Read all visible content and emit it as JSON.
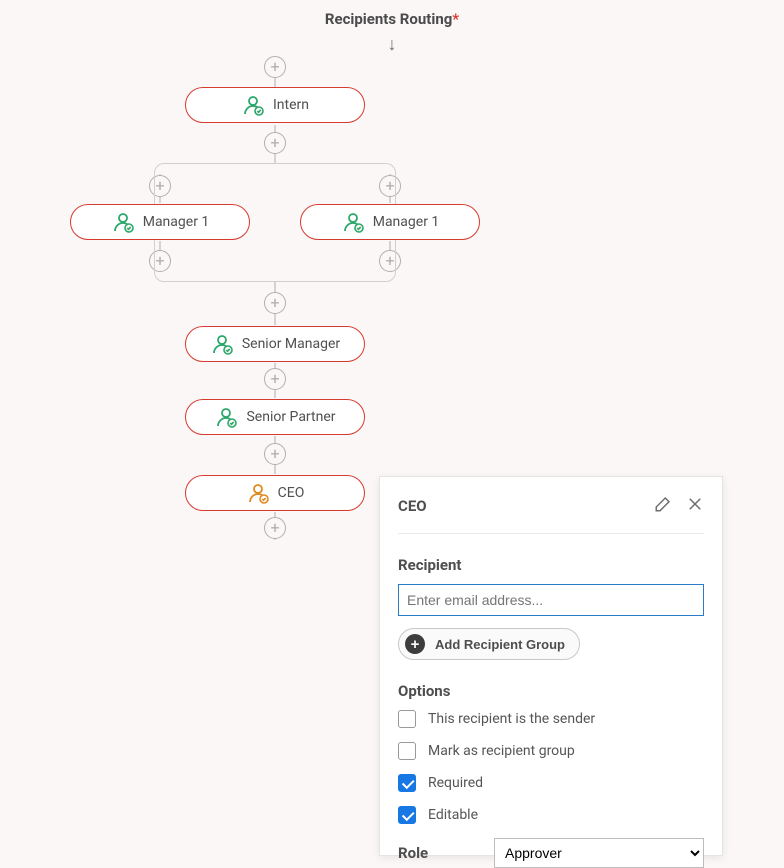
{
  "title": "Recipients Routing",
  "required_mark": "*",
  "nodes": {
    "intern": "Intern",
    "manager1a": "Manager 1",
    "manager1b": "Manager 1",
    "senior_manager": "Senior Manager",
    "senior_partner": "Senior Partner",
    "ceo": "CEO"
  },
  "panel": {
    "title": "CEO",
    "recipient_label": "Recipient",
    "email_placeholder": "Enter email address...",
    "add_group": "Add Recipient Group",
    "options_label": "Options",
    "opt_sender": "This recipient is the sender",
    "opt_group": "Mark as recipient group",
    "opt_required": "Required",
    "opt_editable": "Editable",
    "role_label": "Role",
    "role_value": "Approver"
  }
}
